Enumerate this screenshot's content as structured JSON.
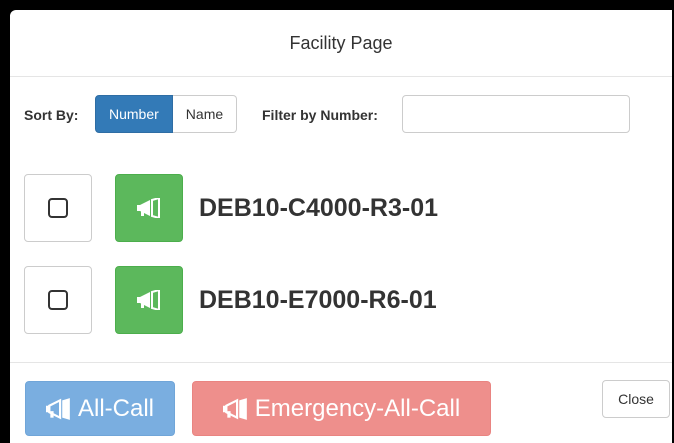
{
  "modal": {
    "title": "Facility Page"
  },
  "toolbar": {
    "sort_label": "Sort By:",
    "sort_options": [
      "Number",
      "Name"
    ],
    "sort_selected": "Number",
    "filter_label": "Filter by Number:",
    "filter_value": "",
    "filter_placeholder": ""
  },
  "facilities": [
    {
      "name": "DEB10-C4000-R3-01",
      "checked": false
    },
    {
      "name": "DEB10-E7000-R6-01",
      "checked": false
    }
  ],
  "footer": {
    "all_call_label": "All-Call",
    "emergency_label": "Emergency-All-Call",
    "close_label": "Close"
  },
  "colors": {
    "primary": "#337ab7",
    "success": "#5cb85c",
    "all_call": "#7aaee0",
    "emergency": "#ee8f8c"
  },
  "icons": {
    "page_button": "bullhorn-icon",
    "all_call": "bullhorn-icon",
    "emergency": "bullhorn-icon"
  }
}
